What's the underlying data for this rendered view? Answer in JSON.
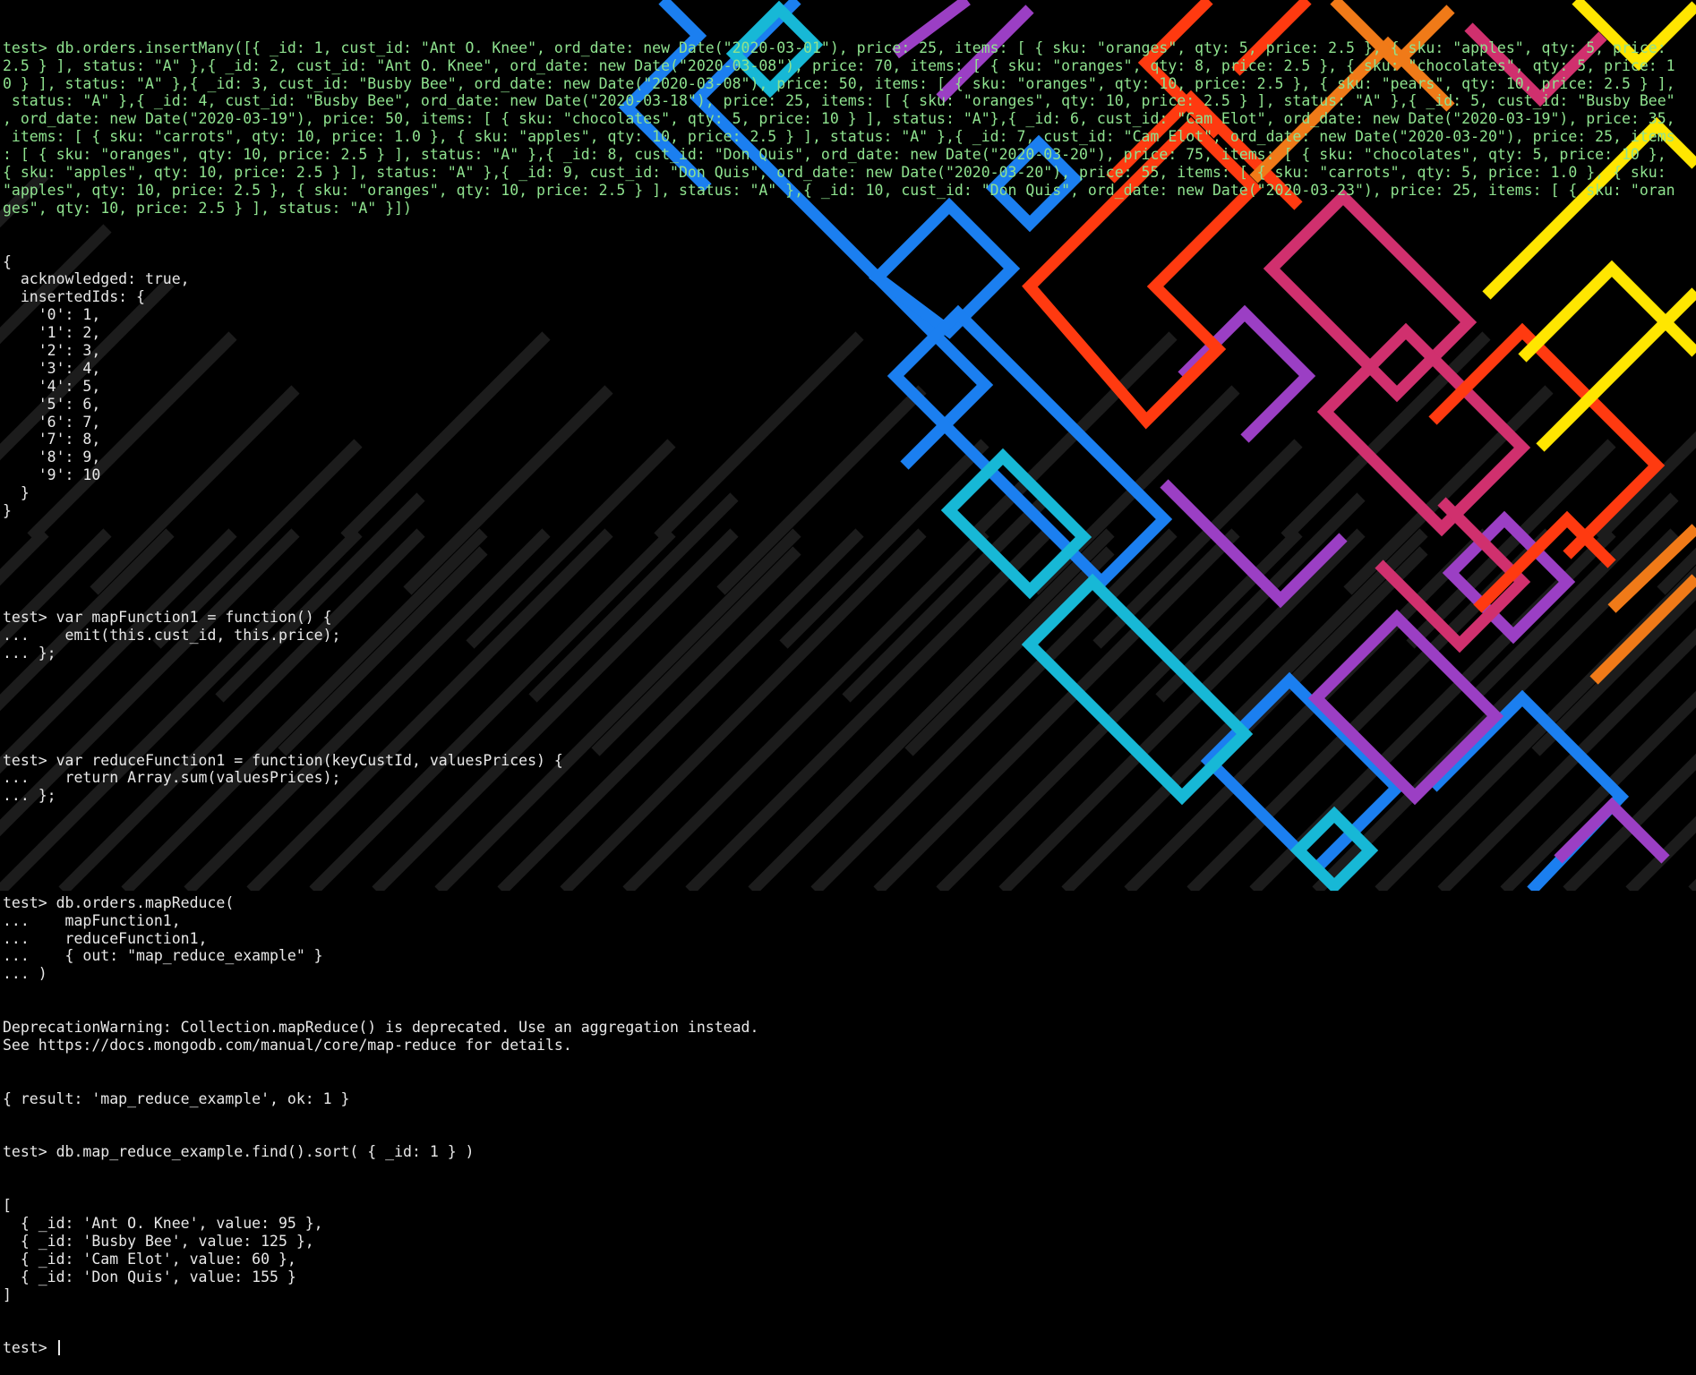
{
  "terminal": {
    "command_insert": [
      "test> db.orders.insertMany([{ _id: 1, cust_id: \"Ant O. Knee\", ord_date: new Date(\"2020-03-01\"), price: 25, items: [ { sku: \"oranges\", qty: 5, price: 2.5 }, { sku: \"apples\", qty: 5, price:",
      "2.5 } ], status: \"A\" },{ _id: 2, cust_id: \"Ant O. Knee\", ord_date: new Date(\"2020-03-08\"), price: 70, items: [ { sku: \"oranges\", qty: 8, price: 2.5 }, { sku: \"chocolates\", qty: 5, price: 1",
      "0 } ], status: \"A\" },{ _id: 3, cust_id: \"Busby Bee\", ord_date: new Date(\"2020-03-08\"), price: 50, items: [ { sku: \"oranges\", qty: 10, price: 2.5 }, { sku: \"pears\", qty: 10, price: 2.5 } ],",
      " status: \"A\" },{ _id: 4, cust_id: \"Busby Bee\", ord_date: new Date(\"2020-03-18\"), price: 25, items: [ { sku: \"oranges\", qty: 10, price: 2.5 } ], status: \"A\" },{ _id: 5, cust_id: \"Busby Bee\"",
      ", ord_date: new Date(\"2020-03-19\"), price: 50, items: [ { sku: \"chocolates\", qty: 5, price: 10 } ], status: \"A\"},{ _id: 6, cust_id: \"Cam Elot\", ord_date: new Date(\"2020-03-19\"), price: 35,",
      " items: [ { sku: \"carrots\", qty: 10, price: 1.0 }, { sku: \"apples\", qty: 10, price: 2.5 } ], status: \"A\" },{ _id: 7, cust_id: \"Cam Elot\", ord_date: new Date(\"2020-03-20\"), price: 25, items",
      ": [ { sku: \"oranges\", qty: 10, price: 2.5 } ], status: \"A\" },{ _id: 8, cust_id: \"Don Quis\", ord_date: new Date(\"2020-03-20\"), price: 75, items: [ { sku: \"chocolates\", qty: 5, price: 10 },",
      "{ sku: \"apples\", qty: 10, price: 2.5 } ], status: \"A\" },{ _id: 9, cust_id: \"Don Quis\", ord_date: new Date(\"2020-03-20\"), price: 55, items: [ { sku: \"carrots\", qty: 5, price: 1.0 }, { sku:",
      "\"apples\", qty: 10, price: 2.5 }, { sku: \"oranges\", qty: 10, price: 2.5 } ], status: \"A\" },{ _id: 10, cust_id: \"Don Quis\", ord_date: new Date(\"2020-03-23\"), price: 25, items: [ { sku: \"oran",
      "ges\", qty: 10, price: 2.5 } ], status: \"A\" }])"
    ],
    "insert_result": [
      "{",
      "  acknowledged: true,",
      "  insertedIds: {",
      "    '0': 1,",
      "    '1': 2,",
      "    '2': 3,",
      "    '3': 4,",
      "    '4': 5,",
      "    '5': 6,",
      "    '6': 7,",
      "    '7': 8,",
      "    '8': 9,",
      "    '9': 10",
      "  }",
      "}"
    ],
    "map_function": [
      "test> var mapFunction1 = function() {",
      "...    emit(this.cust_id, this.price);",
      "... };"
    ],
    "reduce_function": [
      "test> var reduceFunction1 = function(keyCustId, valuesPrices) {",
      "...    return Array.sum(valuesPrices);",
      "... };"
    ],
    "map_reduce_command": [
      "test> db.orders.mapReduce(",
      "...    mapFunction1,",
      "...    reduceFunction1,",
      "...    { out: \"map_reduce_example\" }",
      "... )"
    ],
    "warning": [
      "DeprecationWarning: Collection.mapReduce() is deprecated. Use an aggregation instead.",
      "See https://docs.mongodb.com/manual/core/map-reduce for details."
    ],
    "map_reduce_result": "{ result: 'map_reduce_example', ok: 1 }",
    "find_command": "test> db.map_reduce_example.find().sort( { _id: 1 } )",
    "find_result": [
      "[",
      "  { _id: 'Ant O. Knee', value: 95 },",
      "  { _id: 'Busby Bee', value: 125 },",
      "  { _id: 'Cam Elot', value: 60 },",
      "  { _id: 'Don Quis', value: 155 }",
      "]"
    ],
    "prompt": "test> "
  },
  "colors": {
    "background": "#000000",
    "text": "#e8e8e8",
    "code_green": "#8fe38f",
    "string_green": "#2bd49a",
    "keyword_blue": "#58c8ff",
    "wallpaper_stripes": [
      "#1b7ff0",
      "#17b8d6",
      "#9b3fc4",
      "#d0306e",
      "#ff3a10",
      "#f07a18",
      "#ffe600"
    ]
  }
}
